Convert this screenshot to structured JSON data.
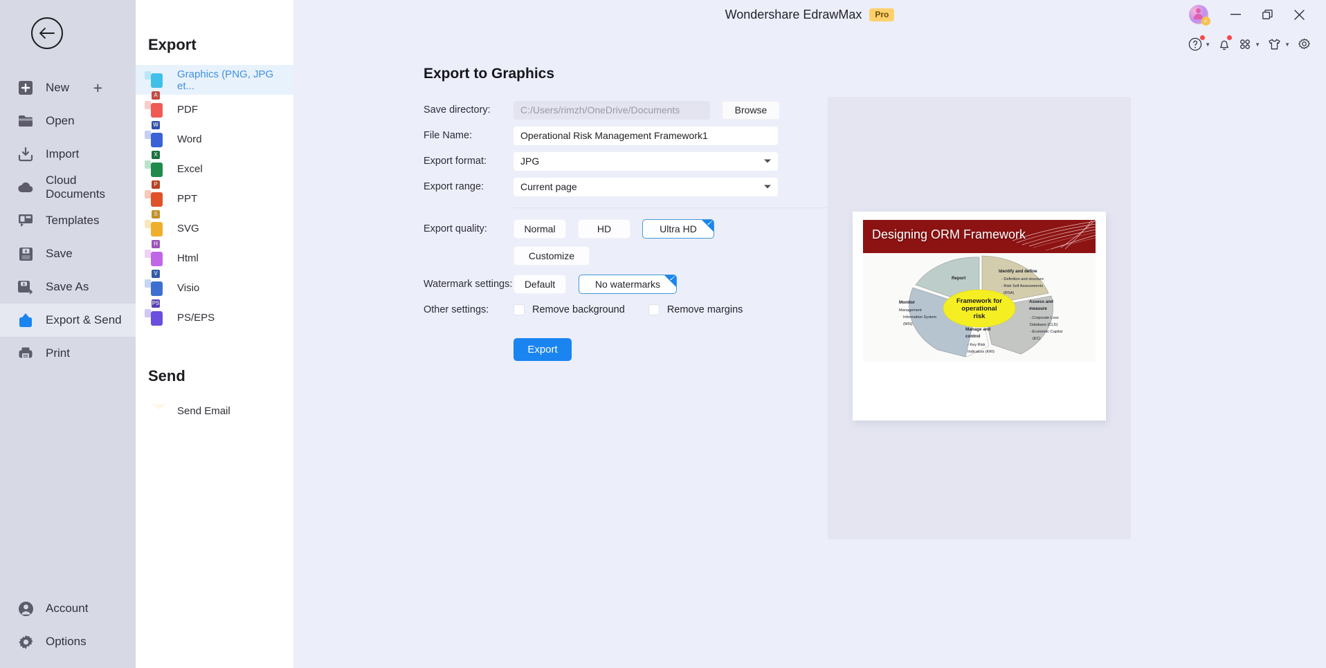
{
  "window": {
    "title": "Wondershare EdrawMax",
    "pro_badge": "Pro",
    "minimize": "minimize-icon",
    "restore": "restore-icon",
    "close": "close-icon"
  },
  "toolbar": {
    "help": "help-icon",
    "notifications": "bell-icon",
    "apps": "grid-icon",
    "theme": "shirt-icon",
    "settings": "gear-icon"
  },
  "leftnav": {
    "back": "back-arrow-icon",
    "items": [
      {
        "label": "New",
        "icon": "new-icon",
        "active": false,
        "trailing": "+"
      },
      {
        "label": "Open",
        "icon": "folder-icon",
        "active": false
      },
      {
        "label": "Import",
        "icon": "import-icon",
        "active": false
      },
      {
        "label": "Cloud Documents",
        "icon": "cloud-icon",
        "active": false
      },
      {
        "label": "Templates",
        "icon": "templates-icon",
        "active": false
      },
      {
        "label": "Save",
        "icon": "save-icon",
        "active": false
      },
      {
        "label": "Save As",
        "icon": "save-as-icon",
        "active": false
      },
      {
        "label": "Export & Send",
        "icon": "export-send-icon",
        "active": true
      },
      {
        "label": "Print",
        "icon": "printer-icon",
        "active": false
      }
    ],
    "bottom": [
      {
        "label": "Account",
        "icon": "account-icon"
      },
      {
        "label": "Options",
        "icon": "options-gear-icon"
      }
    ]
  },
  "export_panel": {
    "heading": "Export",
    "formats": [
      {
        "label": "Graphics (PNG, JPG et...",
        "icon": "graphics-icon",
        "selected": true,
        "color": "#3fc0e8",
        "fold": "#9fe0f4",
        "badge": ""
      },
      {
        "label": "PDF",
        "icon": "pdf-icon",
        "selected": false,
        "color": "#ef5a52",
        "fold": "#f9aba6",
        "badge": "A"
      },
      {
        "label": "Word",
        "icon": "word-icon",
        "selected": false,
        "color": "#3b62d6",
        "fold": "#9fb2ee",
        "badge": "W"
      },
      {
        "label": "Excel",
        "icon": "excel-icon",
        "selected": false,
        "color": "#1f8a4c",
        "fold": "#8fd0ab",
        "badge": "X"
      },
      {
        "label": "PPT",
        "icon": "ppt-icon",
        "selected": false,
        "color": "#e0522a",
        "fold": "#f4a78f",
        "badge": "P"
      },
      {
        "label": "SVG",
        "icon": "svg-icon",
        "selected": false,
        "color": "#efae2c",
        "fold": "#f8d793",
        "badge": "S"
      },
      {
        "label": "Html",
        "icon": "html-icon",
        "selected": false,
        "color": "#c067e8",
        "fold": "#e2b4f4",
        "badge": "H"
      },
      {
        "label": "Visio",
        "icon": "visio-icon",
        "selected": false,
        "color": "#3e6fd0",
        "fold": "#a2bbeb",
        "badge": "V"
      },
      {
        "label": "PS/EPS",
        "icon": "ps-eps-icon",
        "selected": false,
        "color": "#6b4de0",
        "fold": "#b4a4f2",
        "badge": "PS"
      }
    ],
    "send_heading": "Send",
    "send_items": [
      {
        "label": "Send Email",
        "icon": "mail-icon"
      }
    ]
  },
  "form": {
    "title": "Export to Graphics",
    "save_directory": {
      "label": "Save directory:",
      "value": "",
      "placeholder": "C:/Users/rimzh/OneDrive/Documents"
    },
    "browse_label": "Browse",
    "file_name": {
      "label": "File Name:",
      "value": "Operational Risk Management Framework1"
    },
    "export_format": {
      "label": "Export format:",
      "value": "JPG"
    },
    "export_range": {
      "label": "Export range:",
      "value": "Current page"
    },
    "export_quality": {
      "label": "Export quality:",
      "options": [
        "Normal",
        "HD",
        "Ultra HD"
      ],
      "selected": "Ultra HD",
      "customize_label": "Customize"
    },
    "watermark": {
      "label": "Watermark settings:",
      "options": [
        "Default",
        "No watermarks"
      ],
      "selected": "No watermarks"
    },
    "other": {
      "label": "Other settings:",
      "checkboxes": [
        {
          "label": "Remove background",
          "checked": false
        },
        {
          "label": "Remove margins",
          "checked": false
        }
      ]
    },
    "export_button": "Export",
    "accent_color": "#1a84f0"
  },
  "preview": {
    "slide_title": "Designing ORM Framework",
    "header_color": "#8d1313",
    "center_label_lines": [
      "Framework for",
      "operational",
      "risk"
    ],
    "center_color": "#f5ee22",
    "segments": [
      {
        "name": "Report",
        "heading": "Report",
        "color": "#bdcdc9",
        "bullets": []
      },
      {
        "name": "Identify and define",
        "heading": "Identify and define",
        "color": "#d3cdae",
        "bullets": [
          "- Definition and structure",
          "- Risk Self Assessments",
          "(RSA)"
        ]
      },
      {
        "name": "Assess and measure",
        "heading": "Assess and measure",
        "color": "#c3c6c2",
        "bullets": [
          "- Corporate Loss",
          "Database (CLD)",
          "- Economic Capital",
          "(EC)"
        ]
      },
      {
        "name": "Manage and control",
        "heading": "Manage and control",
        "color": "#ffffff",
        "bullets": [
          "- Key Risk",
          "Indicators (KRI)"
        ]
      },
      {
        "name": "Monitor",
        "heading": "Monitor",
        "color": "#b6c4cf",
        "bullets": [
          "Management",
          "Information System",
          "(MIS)"
        ]
      }
    ]
  }
}
